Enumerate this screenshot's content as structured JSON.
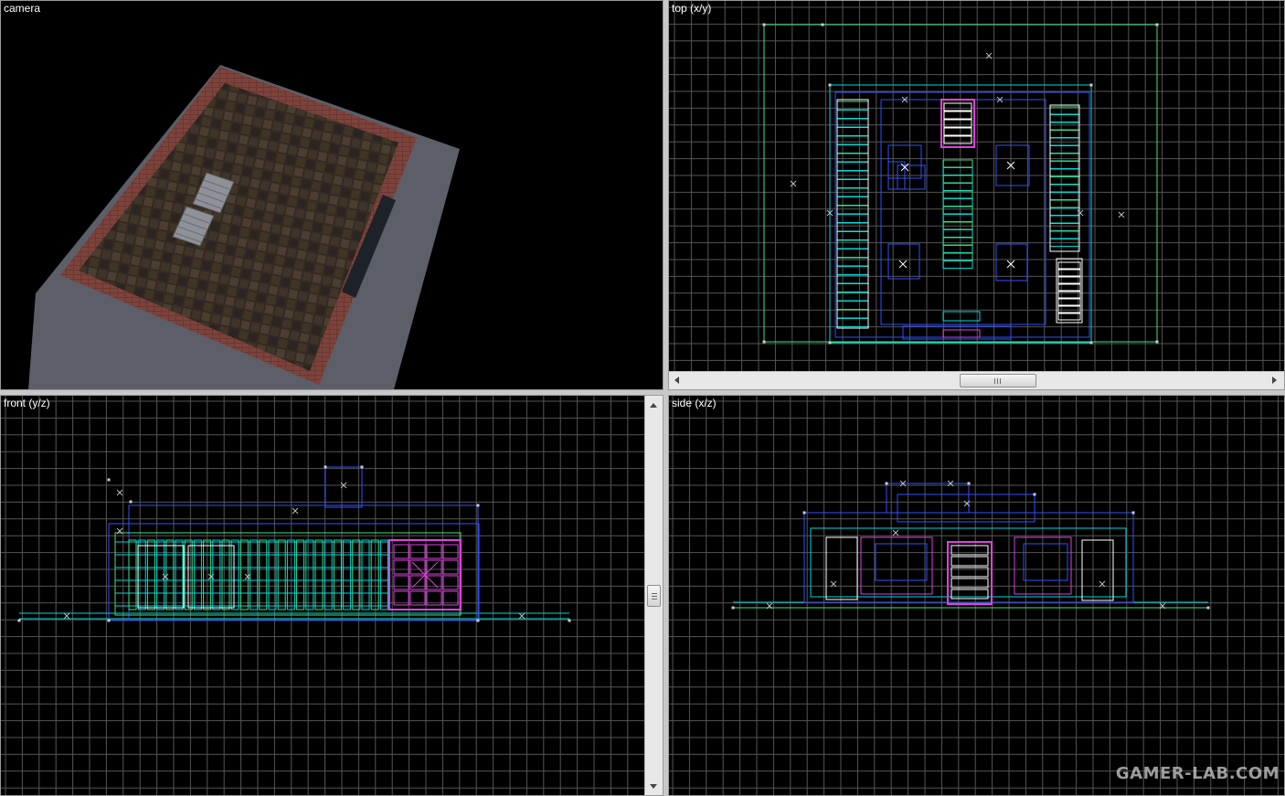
{
  "viewports": {
    "camera": {
      "title": "camera"
    },
    "top": {
      "title": "top (x/y)"
    },
    "front": {
      "title": "front (y/z)"
    },
    "side": {
      "title": "side (x/z)"
    }
  },
  "watermark": "GAMER-LAB.COM",
  "icons": {
    "scroll_left": "arrow-left-icon",
    "scroll_right": "arrow-right-icon",
    "scroll_up": "arrow-up-icon",
    "scroll_down": "arrow-down-icon"
  },
  "colors": {
    "grid_major": "#555555",
    "grid_minor": "#2a2a2a",
    "brush_cyan": "#00d8d8",
    "brush_green": "#40e080",
    "brush_blue": "#3050ff",
    "brush_magenta": "#e040e0",
    "brush_white": "#ffffff",
    "roof": "#3a2f28",
    "brick": "#6e3a34",
    "ground": "#5a5c66"
  }
}
